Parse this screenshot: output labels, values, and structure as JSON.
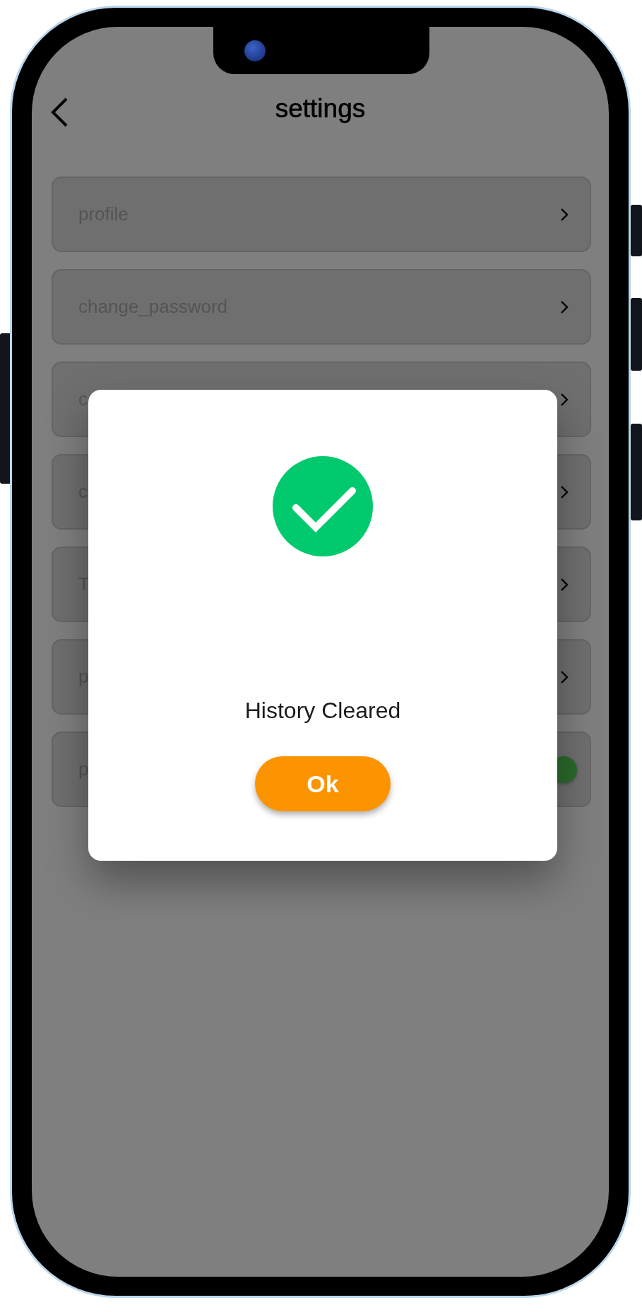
{
  "screen": {
    "title": "settings",
    "items": [
      {
        "label": "profile",
        "kind": "link"
      },
      {
        "label": "change_password",
        "kind": "link"
      },
      {
        "label": "c",
        "kind": "link"
      },
      {
        "label": "c",
        "kind": "link"
      },
      {
        "label": "T",
        "kind": "link"
      },
      {
        "label": "p",
        "kind": "link"
      },
      {
        "label": "p",
        "kind": "toggle",
        "on": true
      }
    ]
  },
  "dialog": {
    "message": "History Cleared",
    "button": "Ok"
  }
}
